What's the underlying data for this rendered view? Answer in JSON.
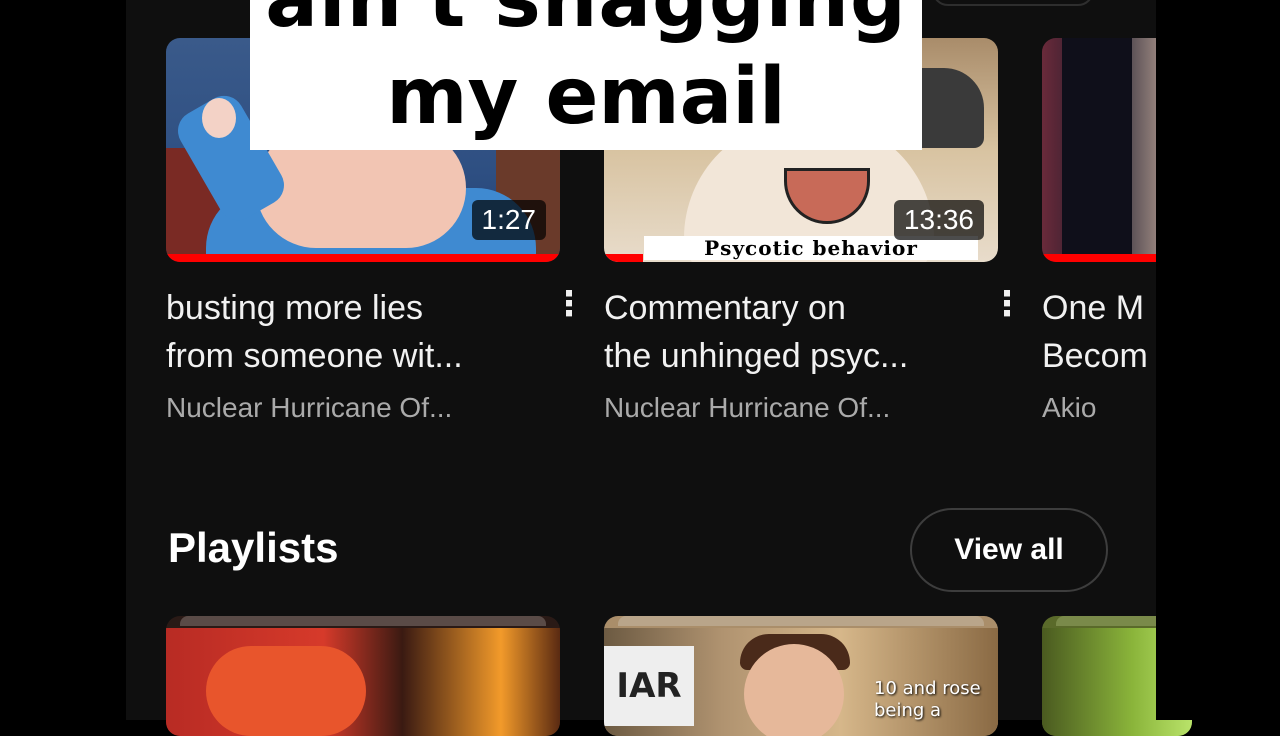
{
  "overlay_caption": {
    "line1": "ain't snagging",
    "line2": "my email"
  },
  "videos": [
    {
      "title_line1": "busting more lies",
      "title_line2": "from someone wit...",
      "channel": "Nuclear Hurricane Of...",
      "duration": "1:27",
      "progress": 1.0
    },
    {
      "title_line1": "Commentary on",
      "title_line2": "the unhinged psyc...",
      "channel": "Nuclear Hurricane Of...",
      "duration": "13:36",
      "thumbnail_text": "Psycotic behavior",
      "progress": 0.1
    },
    {
      "title_line1": "One M",
      "title_line2": "Becom",
      "channel": "Akio",
      "progress": 1.0
    }
  ],
  "playlists_section": {
    "title": "Playlists",
    "view_all_label": "View all",
    "items": [
      {
        "overlay_text": ""
      },
      {
        "sign_text": "IAR",
        "overlay_text": "10 and rose being a"
      },
      {
        "overlay_text": ""
      }
    ]
  },
  "icons": {
    "more": "more-vert-icon"
  },
  "colors": {
    "background": "#0f0f0f",
    "progress": "#ff0000",
    "text": "#f1f1f1",
    "secondary_text": "#aaaaaa"
  }
}
